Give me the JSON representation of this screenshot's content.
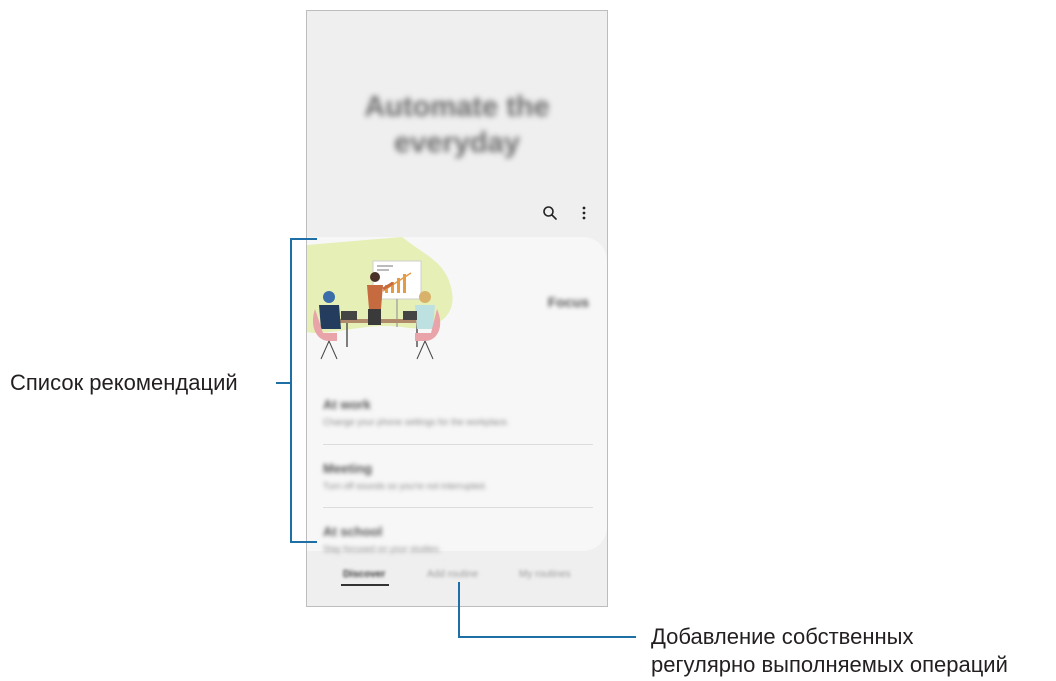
{
  "screen": {
    "hero_title": "Automate the\neveryday",
    "actions": {
      "search_icon": "search-icon",
      "more_icon": "more-vertical-icon"
    }
  },
  "recommendations": {
    "side_label": "Focus",
    "items": [
      {
        "title": "At work",
        "subtitle": "Change your phone settings for the workplace."
      },
      {
        "title": "Meeting",
        "subtitle": "Turn off sounds so you're not interrupted."
      },
      {
        "title": "At school",
        "subtitle": "Stay focused on your studies."
      }
    ]
  },
  "tabs": [
    {
      "label": "Discover",
      "active": true
    },
    {
      "label": "Add routine",
      "active": false
    },
    {
      "label": "My routines",
      "active": false
    }
  ],
  "annotations": {
    "recommendations_list": "Список рекомендаций",
    "add_routine_line1": "Добавление собственных",
    "add_routine_line2": "регулярно выполняемых операций"
  },
  "colors": {
    "callout_line": "#1d6fa5",
    "accent_blob": "#e6efb5"
  }
}
